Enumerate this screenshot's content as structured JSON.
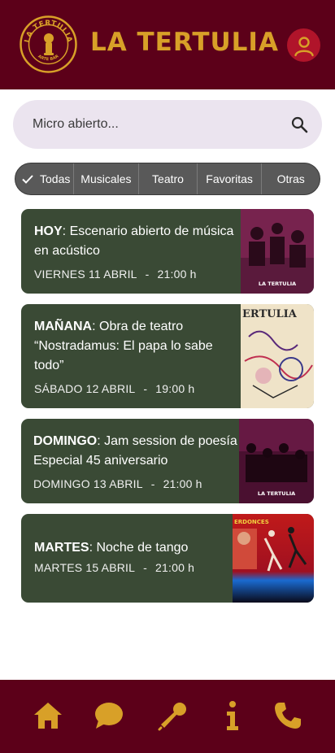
{
  "app": {
    "title": "LA TERTULIA",
    "logo_text_top": "LA TERTULIA",
    "logo_text_bottom": "ARTE BAR"
  },
  "colors": {
    "header_bg": "#5c0019",
    "accent": "#d8a028",
    "card_bg": "#3a4a35",
    "profile_bg": "#b0142a"
  },
  "search": {
    "placeholder": "Micro abierto...",
    "value": ""
  },
  "filters": [
    {
      "label": "Todas",
      "selected": true
    },
    {
      "label": "Musicales",
      "selected": false
    },
    {
      "label": "Teatro",
      "selected": false
    },
    {
      "label": "Favoritas",
      "selected": false
    },
    {
      "label": "Otras",
      "selected": false
    }
  ],
  "events": [
    {
      "day": "HOY",
      "title": ": Escenario abierto de música en acústico",
      "date": "VIERNES 11 ABRIL",
      "sep": "-",
      "time": "21:00 h",
      "image_text": "LA TERTULIA"
    },
    {
      "day": "MAÑANA",
      "title": ": Obra de teatro “Nostradamus: El papa lo sabe todo”",
      "date": "SÁBADO 12 ABRIL",
      "sep": "-",
      "time": "19:00 h",
      "image_text": "ERTULIA"
    },
    {
      "day": "DOMINGO",
      "title": ": Jam session de poesía Especial 45 aniversario",
      "date": "DOMINGO 13 ABRIL",
      "sep": "-",
      "time": "21:00 h",
      "image_text": "LA TERTULIA"
    },
    {
      "day": "MARTES",
      "title": ": Noche de tango",
      "date": "MARTES 15 ABRIL",
      "sep": "-",
      "time": "21:00 h",
      "image_text": "ERDONCES"
    }
  ],
  "nav": [
    "home-icon",
    "chat-icon",
    "microphone-icon",
    "info-icon",
    "phone-icon"
  ]
}
